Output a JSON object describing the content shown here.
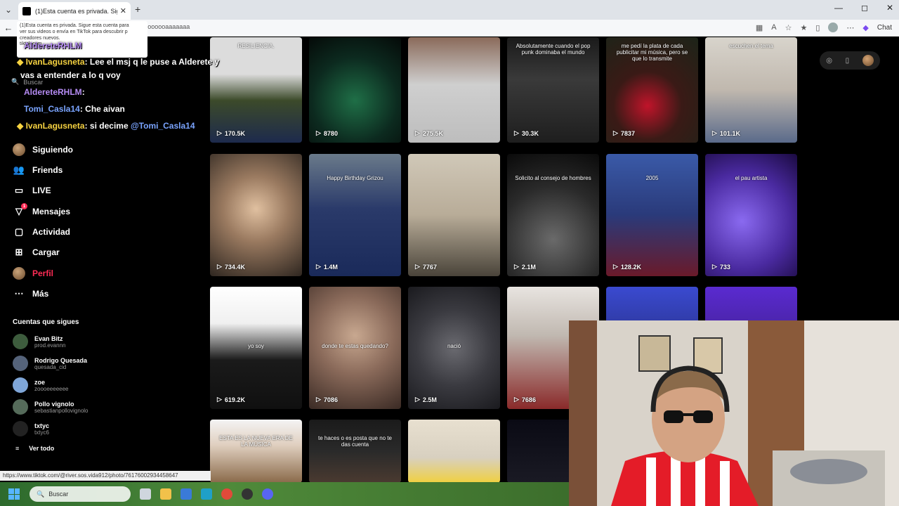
{
  "browser": {
    "tab_title": "(1)Esta cuenta es privada. Sigue es",
    "tab_close": "✕",
    "new_tab": "+",
    "url": "joooooooooooooooooooooooooooooooooooooooooaaaaaaa",
    "chat_label": "Chat",
    "window_buttons": [
      "—",
      "◻",
      "✕"
    ]
  },
  "popup": {
    "lines": [
      "(1)Esta cuenta es privada. Sigue esta cuenta para",
      "ver sus videos o envía en TikTok para descubrir p",
      "creadores nuevos.",
      "tiktok.com"
    ]
  },
  "chat": [
    {
      "user": "AldereteRHLM",
      "msg": "",
      "color": "purple"
    },
    {
      "user": "IvanLagusneta",
      "msg": ": Lee el msj q le puse a Alderete y",
      "color": "yellow"
    },
    {
      "user": "",
      "msg": "vas a entender a lo q voy",
      "color": "white"
    },
    {
      "user": "AldereteRHLM",
      "msg": ":",
      "color": "purple"
    },
    {
      "user": "Tomi_Casla14",
      "msg": ": Che aivan",
      "color": "blue"
    },
    {
      "user": "IvanLagusneta",
      "msg": ": si decime",
      "mention": "@Tomi_Casla14",
      "color": "yellow"
    }
  ],
  "sidebar": {
    "search_placeholder": "Buscar",
    "nav": [
      {
        "label": "Siguiendo",
        "icon": "following-avatar-icon"
      },
      {
        "label": "Friends",
        "icon": "friends-icon"
      },
      {
        "label": "LIVE",
        "icon": "live-icon"
      },
      {
        "label": "Mensajes",
        "icon": "messages-icon",
        "badge": "1"
      },
      {
        "label": "Actividad",
        "icon": "activity-icon"
      },
      {
        "label": "Cargar",
        "icon": "upload-icon"
      },
      {
        "label": "Perfil",
        "icon": "profile-avatar-icon"
      },
      {
        "label": "Más",
        "icon": "more-icon"
      }
    ],
    "following_title": "Cuentas que sigues",
    "following": [
      {
        "name": "Evan Bitz",
        "handle": "prod.evannn",
        "color": "#3d5c3d"
      },
      {
        "name": "Rodrigo Quesada",
        "handle": "quesada_cid",
        "color": "#55637a"
      },
      {
        "name": "zoe",
        "handle": "zoooeeeeeee",
        "color": "#7fa6d8"
      },
      {
        "name": "Pollo vignolo",
        "handle": "sebastianpollovignolo",
        "color": "#556b5a"
      },
      {
        "name": "txtyc",
        "handle": "txtyc6",
        "color": "#222222"
      }
    ],
    "see_all": "Ver todo"
  },
  "videos": [
    {
      "views": "170.5K",
      "caption": "RESILIENCIA.",
      "bg": "linear-gradient(180deg,#dcdcdc 0%,#dcdcdc 35%,#3c4a2a 60%,#1d2a4d 100%)"
    },
    {
      "views": "8780",
      "caption": "",
      "bg": "radial-gradient(circle at 50% 60%,#1f6f47 0%,#0c2a1f 55%,#050a08 100%)"
    },
    {
      "views": "275.5K",
      "caption": "",
      "bg": "linear-gradient(180deg,#8a6a5a 0%,#cfcfcf 45%,#bdbdbd 100%)"
    },
    {
      "views": "30.3K",
      "caption": "Absolutamente cuando el pop punk dominaba el mundo",
      "bg": "linear-gradient(180deg,#1a1a1a 0%,#3a3a3a 40%,#1e1e1e 100%)"
    },
    {
      "views": "7837",
      "caption": "me pedí la plata de cada publicitar mi música, pero se que lo transmite",
      "bg": "radial-gradient(circle at 45% 65%,#c0142a 0%,#3a1a16 40%,#1c2418 100%)"
    },
    {
      "views": "101.1K",
      "caption": "escuchen el tema",
      "bg": "linear-gradient(180deg,#d8d4cc 0%,#c0b8ae 50%,#5a6a8a 100%)"
    },
    {
      "views": "734.4K",
      "caption": "",
      "bg": "radial-gradient(circle at 50% 45%,#e0c0a0 0%,#9a7a60 40%,#2e2620 100%)"
    },
    {
      "views": "1.4M",
      "caption": "Happy Birthday Grizou",
      "bg": "linear-gradient(180deg,#6a7a8a 0%,#2a3a6a 45%,#1a2a5a 100%)"
    },
    {
      "views": "7767",
      "caption": "",
      "bg": "linear-gradient(180deg,#d0c8b8 0%,#b8ac98 50%,#4a443a 100%)"
    },
    {
      "views": "2.1M",
      "caption": "Solicito al consejo de hombres",
      "bg": "radial-gradient(circle at 50% 70%,#6a6a6a 0%,#2a2a2a 55%,#0a0a0a 100%)"
    },
    {
      "views": "128.2K",
      "caption": "2005",
      "bg": "linear-gradient(180deg,#3a5aa8 0%,#2a3a7a 50%,#6a1a2a 100%)"
    },
    {
      "views": "733",
      "caption": "el pau artista",
      "bg": "radial-gradient(circle at 40% 55%,#8a6af0 0%,#4a2aa0 55%,#1a0a40 100%)"
    },
    {
      "views": "619.2K",
      "caption": "yo soy",
      "bg": "linear-gradient(180deg,#ffffff 0%,#f0f0f0 30%,#1a1a1a 60%,#101010 100%)"
    },
    {
      "views": "7086",
      "caption": "donde te estas quedando?",
      "bg": "radial-gradient(circle at 50% 40%,#c8a890 0%,#8a6a5a 45%,#3a2a24 100%)"
    },
    {
      "views": "2.5M",
      "caption": "nació",
      "bg": "radial-gradient(circle at 50% 50%,#6a6a70 0%,#3a3a40 50%,#1a1a1e 100%)"
    },
    {
      "views": "7686",
      "caption": "",
      "bg": "linear-gradient(180deg,#e8e4e0 0%,#c0b8b0 40%,#8a2a2a 100%)"
    },
    {
      "views": "",
      "caption": "",
      "bg": "linear-gradient(180deg,#3a4ad0 0%,#1a1a4a 100%)"
    },
    {
      "views": "",
      "caption": "",
      "bg": "linear-gradient(180deg,#5a2ad0 0%,#2a1a5a 100%)"
    },
    {
      "views": "",
      "caption": "ESTA ES LA NUEVA ERA DE LA MÚSICA",
      "bg": "linear-gradient(180deg,#f4f4f4 0%,#e0d0c0 40%,#8a6a4a 100%)"
    },
    {
      "views": "",
      "caption": "te haces o es posta que no te das cuenta",
      "bg": "linear-gradient(180deg,#1a1a1a 0%,#2a2a2a 50%,#4a3a30 100%)"
    },
    {
      "views": "",
      "caption": "",
      "bg": "linear-gradient(180deg,#e8e0d0 0%,#d8d0c0 60%,#f0d040 100%)"
    },
    {
      "views": "",
      "caption": "",
      "bg": "linear-gradient(180deg,#0a0a14 0%,#1a1a24 100%)"
    }
  ],
  "status_url": "https://www.tiktok.com/@river.sos.vida912/photo/76176002934458647",
  "taskbar": {
    "search_placeholder": "Buscar",
    "icons": [
      "file-explorer-icon",
      "folder-icon",
      "store-icon",
      "edge-icon",
      "chrome-icon",
      "obs-icon",
      "discord-icon"
    ]
  }
}
